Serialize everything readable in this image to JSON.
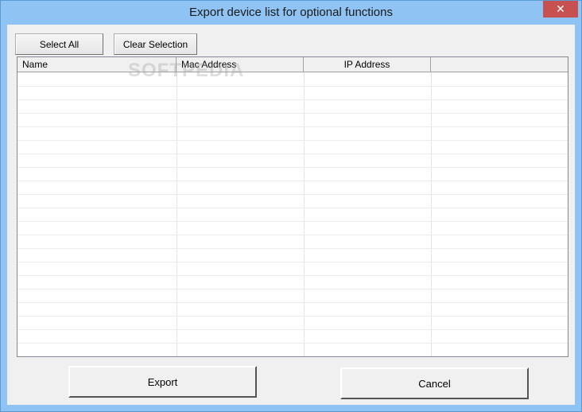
{
  "window": {
    "title": "Export device list for optional functions",
    "close_glyph": "✕"
  },
  "toolbar": {
    "select_all_label": "Select All",
    "clear_selection_label": "Clear Selection"
  },
  "watermark": "SOFTPEDIA",
  "table": {
    "columns": [
      "Name",
      "Mac Address",
      "IP Address",
      ""
    ],
    "rows": []
  },
  "footer": {
    "export_label": "Export",
    "cancel_label": "Cancel"
  }
}
